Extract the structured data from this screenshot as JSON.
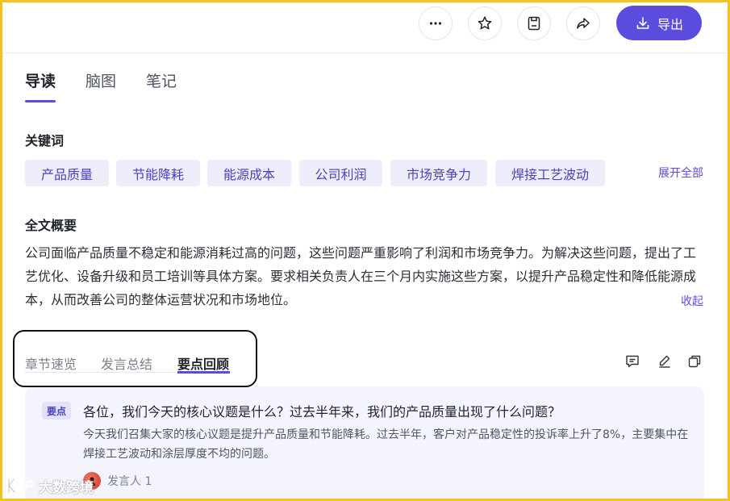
{
  "toolbar": {
    "more_icon": "more-horizontal-icon",
    "star_icon": "star-icon",
    "save_icon": "save-icon",
    "share_icon": "share-icon",
    "export_label": "导出",
    "export_icon": "download-icon"
  },
  "main_tabs": [
    {
      "label": "导读",
      "active": true
    },
    {
      "label": "脑图",
      "active": false
    },
    {
      "label": "笔记",
      "active": false
    }
  ],
  "keywords": {
    "title": "关键词",
    "items": [
      "产品质量",
      "节能降耗",
      "能源成本",
      "公司利润",
      "市场竞争力",
      "焊接工艺波动"
    ],
    "expand_label": "展开全部"
  },
  "summary": {
    "title": "全文概要",
    "text": "公司面临产品质量不稳定和能源消耗过高的问题，这些问题严重影响了利润和市场竞争力。为解决这些问题，提出了工艺优化、设备升级和员工培训等具体方案。要求相关负责人在三个月内实施这些方案，以提升产品稳定性和降低能源成本，从而改善公司的整体运营状况和市场地位。",
    "collapse_label": "收起"
  },
  "sub_tabs": [
    {
      "label": "章节速览",
      "active": false
    },
    {
      "label": "发言总结",
      "active": false
    },
    {
      "label": "要点回顾",
      "active": true
    }
  ],
  "card": {
    "badge": "要点",
    "question": "各位，我们今天的核心议题是什么？过去半年来，我们的产品质量出现了什么问题？",
    "answer": "今天我们召集大家的核心议题是提升产品质量和节能降耗。过去半年，客户对产品稳定性的投诉率上升了8%，主要集中在焊接工艺波动和涂层厚度不均的问题。",
    "speaker": "发言人 1"
  },
  "watermark": {
    "text": "大数跨境"
  },
  "colors": {
    "accent": "#5b4cde",
    "keyword_bg": "#eeedfc",
    "card_bg": "#f4f4fd",
    "frame": "#f2c318"
  }
}
